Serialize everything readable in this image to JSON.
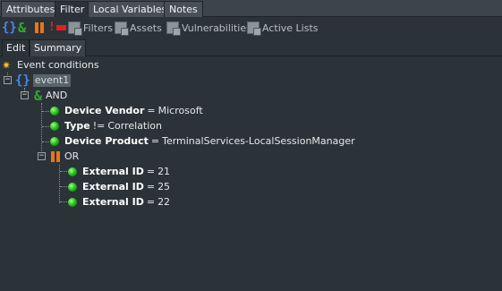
{
  "top_tabs": [
    "Attributes",
    "Filter",
    "Local Variables",
    "Notes"
  ],
  "active_top_tab": "Filter",
  "toolbar": {
    "filters_label": "Filters",
    "assets_label": "Assets",
    "vulnerabilities_label": "Vulnerabilities",
    "active_lists_label": "Active Lists",
    "colors": {
      "braces": "#4d86e8",
      "and": "#2faa2f",
      "or": "#e9761a",
      "not": "#e02020"
    }
  },
  "sub_tabs": [
    "Edit",
    "Summary"
  ],
  "active_sub_tab": "Edit",
  "tree": {
    "root_label": "Event conditions",
    "event_label": "event1",
    "and_label": "AND",
    "conditions": [
      {
        "field": "Device Vendor",
        "op": "=",
        "value": "Microsoft"
      },
      {
        "field": "Type",
        "op": "!=",
        "value": "Correlation"
      },
      {
        "field": "Device Product",
        "op": "=",
        "value": "TerminalServices-LocalSessionManager"
      }
    ],
    "or_label": "OR",
    "or_conditions": [
      {
        "field": "External ID",
        "op": "=",
        "value": "21"
      },
      {
        "field": "External ID",
        "op": "=",
        "value": "25"
      },
      {
        "field": "External ID",
        "op": "=",
        "value": "22"
      }
    ]
  }
}
